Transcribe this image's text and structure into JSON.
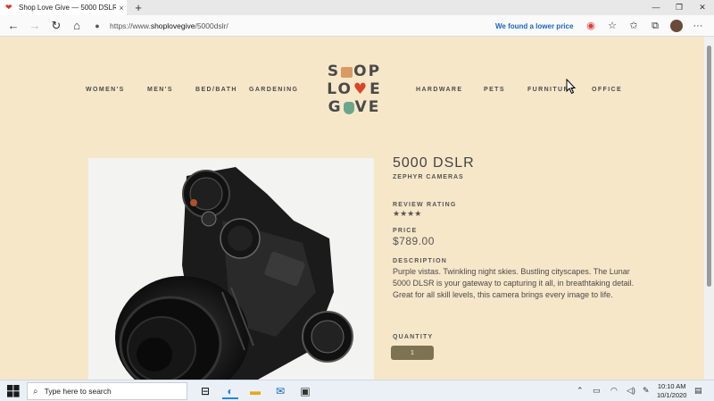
{
  "browser": {
    "tab_title": "Shop Love Give — 5000 DSLR - S",
    "tab_close": "×",
    "new_tab": "+",
    "url_host": "https://www.",
    "url_domain": "shoplovegive",
    "url_path": "/5000dslr/",
    "lower_price_text": "We found a lower price",
    "back_glyph": "←",
    "forward_glyph": "→",
    "refresh_glyph": "↻",
    "home_glyph": "⌂",
    "lock_glyph": "🔒",
    "minimize_glyph": "—",
    "maximize_glyph": "❐",
    "close_glyph": "✕",
    "icons": [
      "back-icon",
      "forward-icon",
      "refresh-icon",
      "home-icon",
      "lock-icon",
      "coupon-icon",
      "favorite-star-icon",
      "favorites-list-icon",
      "collections-icon",
      "profile-avatar",
      "more-icon"
    ]
  },
  "site": {
    "nav_left": [
      "WOMEN'S",
      "MEN'S",
      "BED/BATH",
      "GARDENING"
    ],
    "nav_right": [
      "HARDWARE",
      "PETS",
      "FURNITURE",
      "OFFICE"
    ],
    "logo_line1_a": "S",
    "logo_line1_b": "OP",
    "logo_line2_a": "LO",
    "logo_line2_b": "E",
    "logo_line3_a": "G",
    "logo_line3_b": "VE"
  },
  "product": {
    "name": "5000 DSLR",
    "brand": "ZEPHYR CAMERAS",
    "review_label": "REVIEW RATING",
    "rating": 4,
    "rating_display": "★★★★",
    "price_label": "PRICE",
    "price": "$789.00",
    "description_label": "DESCRIPTION",
    "description": "Purple vistas. Twinkling night skies. Bustling cityscapes. The Lunar 5000 DLSR is your gateway to capturing it all, in breathtaking detail.  Great for all skill levels, this camera brings every image to life.",
    "quantity_label": "QUANTITY",
    "quantity_value": "1"
  },
  "taskbar": {
    "search_placeholder": "Type here to search",
    "time": "10:10 AM",
    "date": "10/1/2020"
  },
  "colors": {
    "page_bg": "#f7e7c9",
    "accent_price_banner": "#1565c0",
    "quantity_button": "#7d7352",
    "logo_heart": "#d9452b",
    "logo_bag": "#d99a66",
    "logo_hand": "#6aa68c"
  }
}
